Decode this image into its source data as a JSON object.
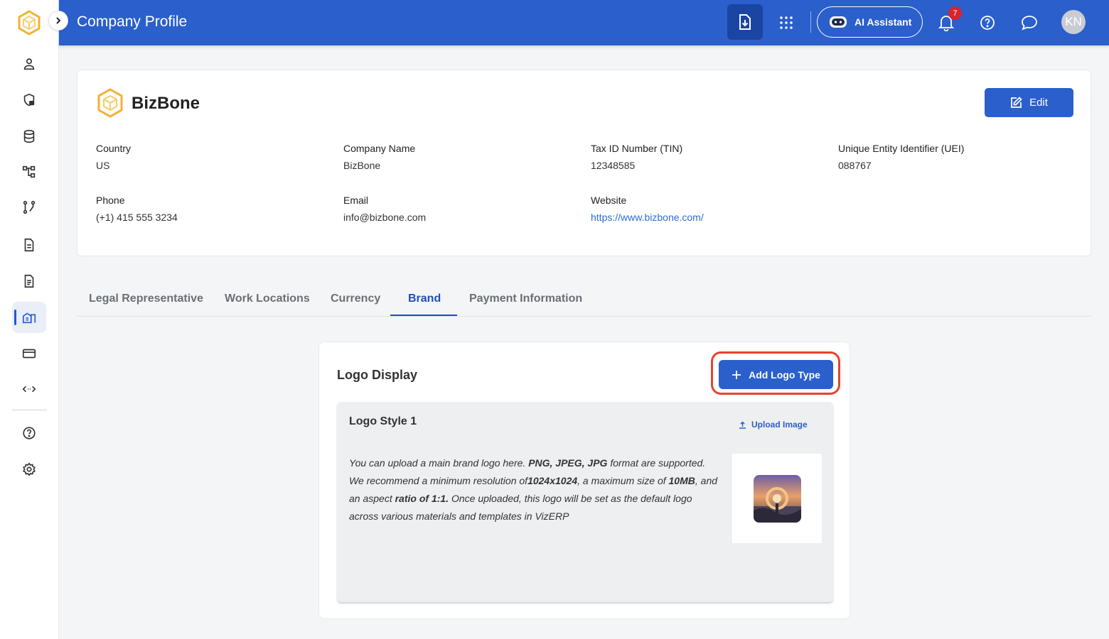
{
  "header": {
    "title": "Company Profile",
    "ai_assistant_label": "AI Assistant",
    "notification_count": "7",
    "avatar_initials": "KN",
    "accent_color": "#2a5fcc"
  },
  "sidebar": {
    "items": [
      {
        "icon": "user-icon"
      },
      {
        "icon": "shield-lock-icon"
      },
      {
        "icon": "database-icon"
      },
      {
        "icon": "hierarchy-icon"
      },
      {
        "icon": "workflow-icon"
      },
      {
        "icon": "document-icon"
      },
      {
        "icon": "document-list-icon"
      },
      {
        "icon": "company-building-icon",
        "active": true
      },
      {
        "icon": "credit-card-icon"
      },
      {
        "icon": "api-arrows-icon"
      },
      {
        "icon": "help-icon"
      },
      {
        "icon": "settings-icon"
      }
    ]
  },
  "company": {
    "name": "BizBone",
    "edit_label": "Edit",
    "fields": {
      "country": {
        "label": "Country",
        "value": "US"
      },
      "company_name": {
        "label": "Company Name",
        "value": "BizBone"
      },
      "tin": {
        "label": "Tax ID Number (TIN)",
        "value": "12348585"
      },
      "uei": {
        "label": "Unique Entity Identifier (UEI)",
        "value": "088767"
      },
      "phone": {
        "label": "Phone",
        "value": "(+1) 415 555 3234"
      },
      "email": {
        "label": "Email",
        "value": "info@bizbone.com"
      },
      "website": {
        "label": "Website",
        "value": "https://www.bizbone.com/"
      }
    }
  },
  "tabs": [
    {
      "label": "Legal Representative"
    },
    {
      "label": "Work Locations"
    },
    {
      "label": "Currency"
    },
    {
      "label": "Brand",
      "active": true
    },
    {
      "label": "Payment Information"
    }
  ],
  "logo_display": {
    "title": "Logo Display",
    "add_button_label": "Add Logo Type",
    "style": {
      "title": "Logo Style 1",
      "upload_label": "Upload Image",
      "desc": {
        "t1": "You can upload a main brand logo here. ",
        "b1": "PNG, JPEG, JPG",
        "t2": " format are supported. We recommend a minimum resolution of",
        "b2": "1024x1024",
        "t3": ", a maximum size of ",
        "b3": "10MB",
        "t4": ", and an aspect ",
        "b4": "ratio of 1:1.",
        "t5": " Once uploaded, this logo will be set as the default logo across various materials and templates in VizERP"
      }
    }
  }
}
